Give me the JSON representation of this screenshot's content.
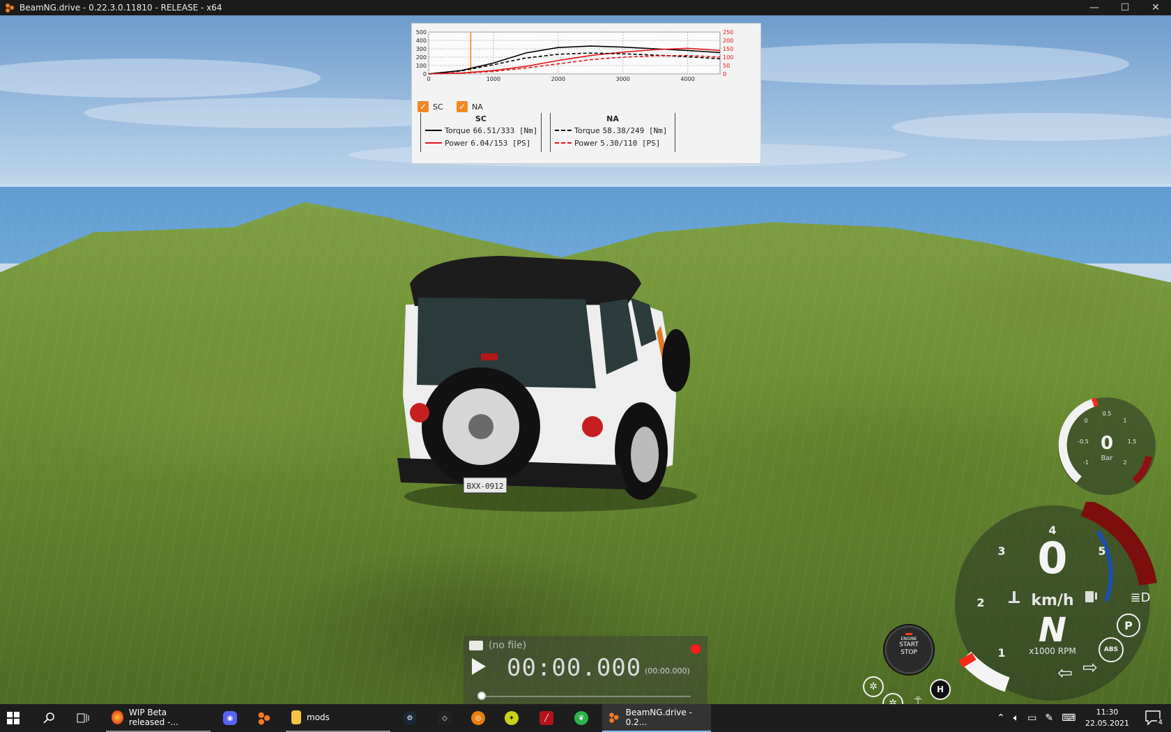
{
  "window": {
    "title": "BeamNG.drive - 0.22.3.0.11810 - RELEASE - x64",
    "controls": [
      "—",
      "☐",
      "✕"
    ]
  },
  "graph": {
    "chart_data": {
      "type": "line",
      "x_ticks": [
        "0",
        "1000",
        "2000",
        "3000",
        "4000"
      ],
      "y_left_ticks": [
        "500",
        "400",
        "300",
        "200",
        "100",
        "0"
      ],
      "y_right_ticks": [
        "250",
        "200",
        "150",
        "100",
        "50",
        "0"
      ],
      "xlim": [
        0,
        4500
      ],
      "ylim_left": [
        0,
        500
      ],
      "ylim_right": [
        0,
        250
      ],
      "cursor_rpm": 650,
      "series": [
        {
          "name": "SC Torque",
          "axis": "left",
          "color": "#000000",
          "dash": false,
          "x": [
            0,
            500,
            1000,
            1500,
            2000,
            2500,
            3000,
            3500,
            4000,
            4500
          ],
          "y": [
            0,
            40,
            130,
            250,
            315,
            333,
            320,
            300,
            280,
            255
          ]
        },
        {
          "name": "SC Power",
          "axis": "right",
          "color": "#e0161b",
          "dash": false,
          "x": [
            0,
            500,
            1000,
            1500,
            2000,
            2500,
            3000,
            3500,
            4000,
            4500
          ],
          "y": [
            0,
            5,
            20,
            45,
            80,
            110,
            130,
            145,
            153,
            140
          ]
        },
        {
          "name": "NA Torque",
          "axis": "left",
          "color": "#000000",
          "dash": true,
          "x": [
            0,
            500,
            1000,
            1500,
            2000,
            2500,
            3000,
            3500,
            4000,
            4500
          ],
          "y": [
            0,
            35,
            110,
            190,
            235,
            249,
            240,
            225,
            205,
            180
          ]
        },
        {
          "name": "NA Power",
          "axis": "right",
          "color": "#e0161b",
          "dash": true,
          "x": [
            0,
            500,
            1000,
            1500,
            2000,
            2500,
            3000,
            3500,
            4000,
            4500
          ],
          "y": [
            0,
            4,
            15,
            35,
            60,
            85,
            100,
            108,
            110,
            100
          ]
        }
      ]
    },
    "toggles": [
      {
        "label": "SC",
        "checked": true
      },
      {
        "label": "NA",
        "checked": true
      }
    ],
    "legend": {
      "sc": {
        "title": "SC",
        "torque_label": "Torque",
        "torque_value": "66.51/333 [Nm]",
        "power_label": "Power",
        "power_value": "6.04/153  [PS]"
      },
      "na": {
        "title": "NA",
        "torque_label": "Torque",
        "torque_value": "58.38/249 [Nm]",
        "power_label": "Power",
        "power_value": "5.30/110  [PS]"
      }
    }
  },
  "vehicle": {
    "plate": "BXX-0912"
  },
  "replay": {
    "file": "(no file)",
    "time": "00:00.000",
    "time_sub": "(00:00.000)"
  },
  "boost_gauge": {
    "value": "0",
    "unit": "Bar",
    "ticks": [
      "0",
      "0.5",
      "1",
      "1.5",
      "2",
      "-0.5",
      "-1"
    ]
  },
  "tachometer": {
    "speed": "0",
    "speed_unit": "km/h",
    "gear": "N",
    "rpm_label": "x1000 RPM",
    "rpm_ticks": [
      "1",
      "2",
      "3",
      "4",
      "5"
    ]
  },
  "start_stop": {
    "line1": "ENGINE",
    "line2": "START",
    "line3": "STOP"
  },
  "hud_icons": {
    "parking": "P",
    "abs": "ABS",
    "handbrake": "H"
  },
  "taskbar": {
    "tasks": [
      {
        "label": "WIP Beta released -..."
      },
      {
        "label": "mods"
      },
      {
        "label": "BeamNG.drive - 0.2..."
      }
    ],
    "time": "11:30",
    "date": "22.05.2021",
    "notifications": "4"
  },
  "colors": {
    "accent_orange": "#f08a24",
    "red": "#e0161b",
    "taskbar": "#1d1d1d"
  }
}
